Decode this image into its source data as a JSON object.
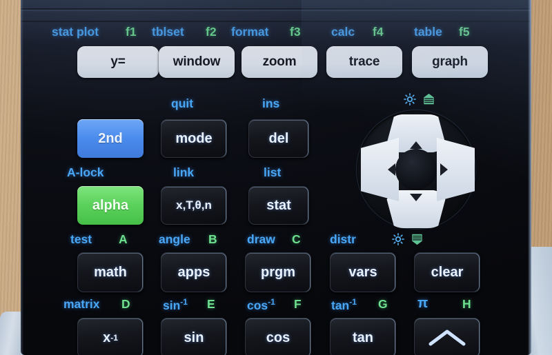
{
  "device": {
    "name": "graphing-calculator-keypad",
    "body_color": "#0c0e15",
    "accent_blue": "#49a7f5",
    "accent_green": "#6fe08f",
    "key_white": "#eef2f8",
    "key_2nd_color": "#4a8bec",
    "key_alpha_color": "#5ad15a",
    "background_color": "#c4a179"
  },
  "rows": {
    "graph_row": {
      "secondary_labels": [
        {
          "text": "stat plot",
          "color": "blue"
        },
        {
          "text": "f1",
          "color": "green"
        },
        {
          "text": "tblset",
          "color": "blue"
        },
        {
          "text": "f2",
          "color": "green"
        },
        {
          "text": "format",
          "color": "blue"
        },
        {
          "text": "f3",
          "color": "green"
        },
        {
          "text": "calc",
          "color": "blue"
        },
        {
          "text": "f4",
          "color": "green"
        },
        {
          "text": "table",
          "color": "blue"
        },
        {
          "text": "f5",
          "color": "green"
        }
      ],
      "keys": [
        {
          "label": "y=",
          "style": "white"
        },
        {
          "label": "window",
          "style": "white"
        },
        {
          "label": "zoom",
          "style": "white"
        },
        {
          "label": "trace",
          "style": "white"
        },
        {
          "label": "graph",
          "style": "white"
        }
      ]
    },
    "row_2nd": {
      "secondary_labels": [
        {
          "text": "quit",
          "color": "blue"
        },
        {
          "text": "ins",
          "color": "blue"
        }
      ],
      "keys": [
        {
          "label": "2nd",
          "style": "blue"
        },
        {
          "label": "mode",
          "style": "black"
        },
        {
          "label": "del",
          "style": "black"
        }
      ]
    },
    "row_alpha": {
      "secondary_labels": [
        {
          "text": "A-lock",
          "color": "blue"
        },
        {
          "text": "link",
          "color": "blue"
        },
        {
          "text": "list",
          "color": "blue"
        }
      ],
      "keys": [
        {
          "label": "alpha",
          "style": "green"
        },
        {
          "label": "x,T,θ,n",
          "style": "black"
        },
        {
          "label": "stat",
          "style": "black"
        }
      ]
    },
    "row_math": {
      "secondary_labels": [
        {
          "text": "test",
          "color": "blue"
        },
        {
          "text": "A",
          "color": "green"
        },
        {
          "text": "angle",
          "color": "blue"
        },
        {
          "text": "B",
          "color": "green"
        },
        {
          "text": "draw",
          "color": "blue"
        },
        {
          "text": "C",
          "color": "green"
        },
        {
          "text": "distr",
          "color": "blue"
        }
      ],
      "keys": [
        {
          "label": "math",
          "style": "black"
        },
        {
          "label": "apps",
          "style": "black"
        },
        {
          "label": "prgm",
          "style": "black"
        },
        {
          "label": "vars",
          "style": "black"
        },
        {
          "label": "clear",
          "style": "black"
        }
      ]
    },
    "row_trig": {
      "secondary_labels": [
        {
          "text": "matrix",
          "color": "blue"
        },
        {
          "text": "D",
          "color": "green"
        },
        {
          "text": "sin",
          "sup": "-1",
          "color": "blue"
        },
        {
          "text": "E",
          "color": "green"
        },
        {
          "text": "cos",
          "sup": "-1",
          "color": "blue"
        },
        {
          "text": "F",
          "color": "green"
        },
        {
          "text": "tan",
          "sup": "-1",
          "color": "blue"
        },
        {
          "text": "G",
          "color": "green"
        },
        {
          "text": "π",
          "color": "blue"
        },
        {
          "text": "H",
          "color": "green"
        }
      ],
      "keys": [
        {
          "label": "x",
          "sup": "-1",
          "style": "black"
        },
        {
          "label": "sin",
          "style": "black"
        },
        {
          "label": "cos",
          "style": "black"
        },
        {
          "label": "tan",
          "style": "black"
        },
        {
          "label": "^",
          "style": "black",
          "icon": "caret-icon"
        }
      ]
    }
  },
  "dpad": {
    "up": "▲",
    "down": "▼",
    "left": "◀",
    "right": "▶"
  },
  "contrast_icons": {
    "top_sun": "brightness-up-icon",
    "top_stack": "contrast-up-icon",
    "bottom_sun": "brightness-down-icon",
    "bottom_stack": "contrast-down-icon"
  }
}
